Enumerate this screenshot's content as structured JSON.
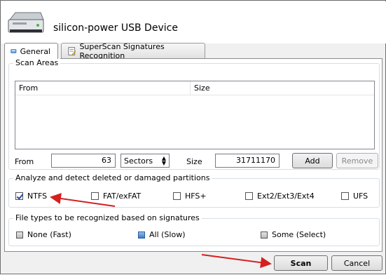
{
  "window": {
    "device_title": "silicon-power USB Device"
  },
  "tabs": [
    {
      "label": "General",
      "active": true
    },
    {
      "label": "SuperScan Signatures Recognition",
      "active": false
    }
  ],
  "scan_areas": {
    "title": "Scan Areas",
    "columns": [
      "From",
      "Size"
    ],
    "rows": [],
    "from_label": "From",
    "from_value": "63",
    "unit_value": "Sectors",
    "size_label": "Size",
    "size_value": "31711170",
    "add_label": "Add",
    "remove_label": "Remove"
  },
  "partitions": {
    "title": "Analyze and detect deleted or damaged partitions",
    "options": [
      {
        "label": "NTFS",
        "checked": true
      },
      {
        "label": "FAT/exFAT",
        "checked": false
      },
      {
        "label": "HFS+",
        "checked": false
      },
      {
        "label": "Ext2/Ext3/Ext4",
        "checked": false
      },
      {
        "label": "UFS",
        "checked": false
      }
    ]
  },
  "file_types": {
    "title": "File types to be recognized based on signatures",
    "options": [
      {
        "label": "None (Fast)",
        "selected": false
      },
      {
        "label": "All (Slow)",
        "selected": true
      },
      {
        "label": "Some (Select)",
        "selected": false
      }
    ]
  },
  "footer": {
    "scan_label": "Scan",
    "cancel_label": "Cancel"
  },
  "colors": {
    "annotation_arrow": "#d42020",
    "selected_radio": "#3a7cc8"
  }
}
